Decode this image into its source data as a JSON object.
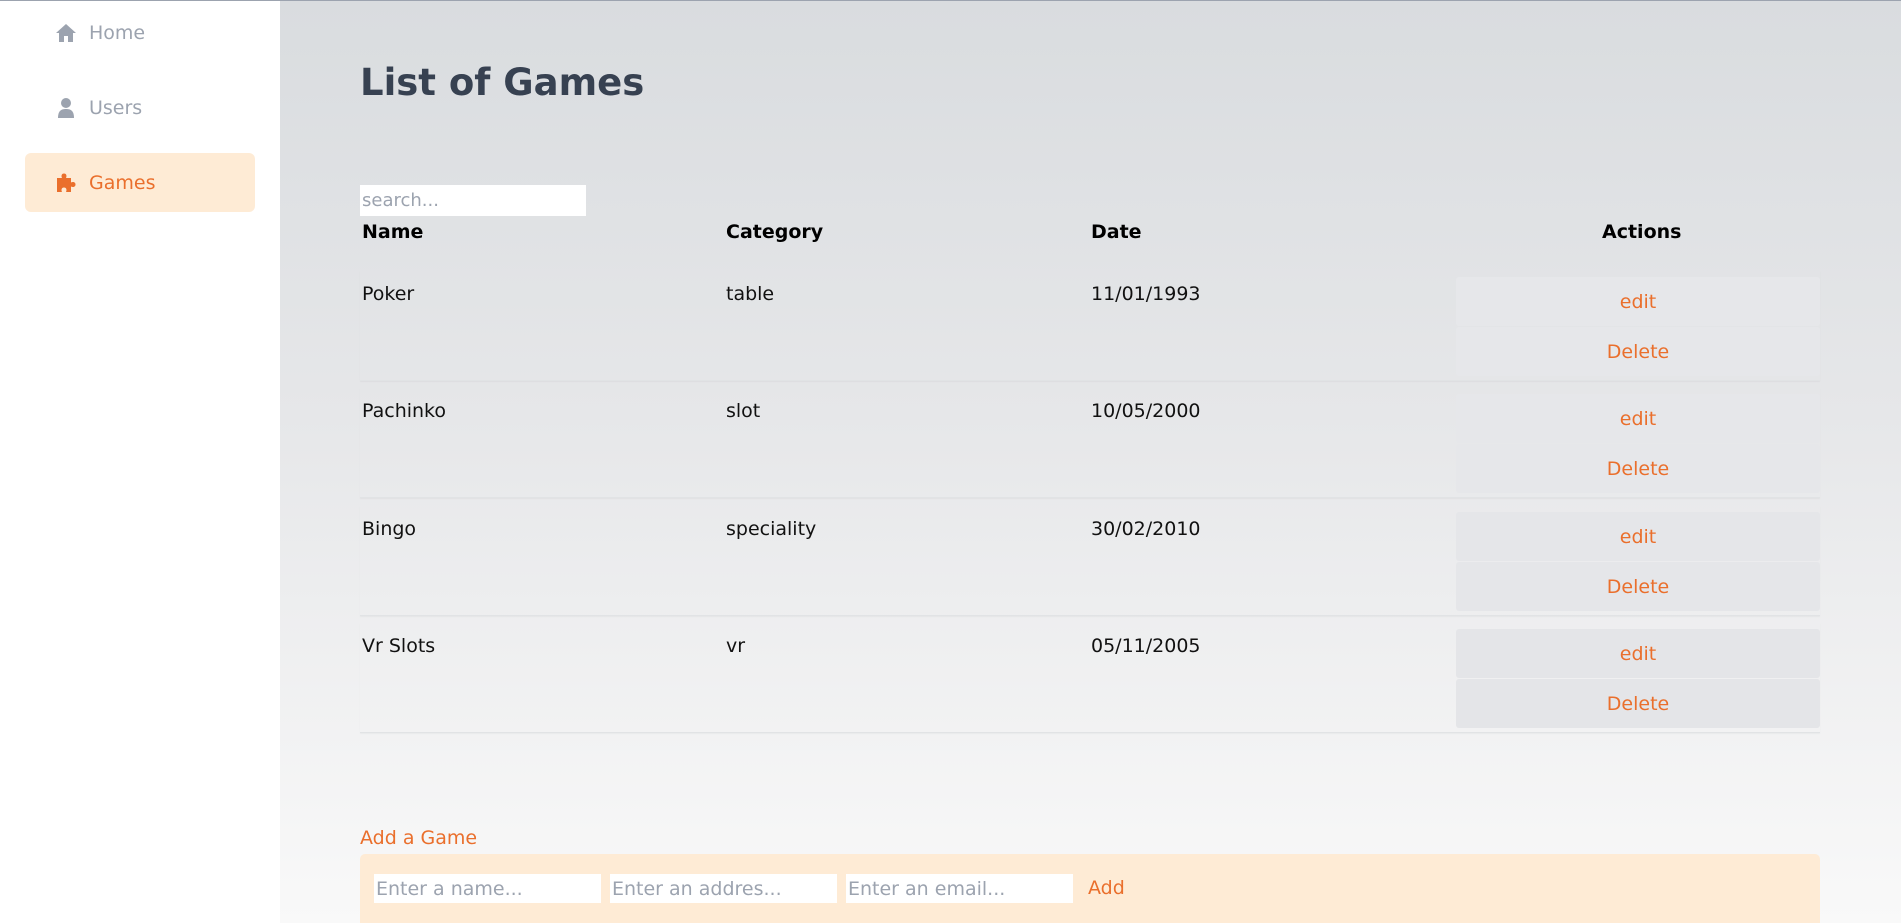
{
  "sidebar": {
    "items": [
      {
        "label": "Home",
        "icon": "home-icon"
      },
      {
        "label": "Users",
        "icon": "user-icon"
      },
      {
        "label": "Games",
        "icon": "puzzle-icon",
        "active": true
      }
    ]
  },
  "main": {
    "title": "List of Games",
    "search": {
      "placeholder": "search...",
      "value": ""
    },
    "table": {
      "headers": {
        "name": "Name",
        "category": "Category",
        "date": "Date",
        "actions": "Actions"
      },
      "rows": [
        {
          "name": "Poker",
          "category": "table",
          "date": "11/01/1993",
          "edit_label": "edit",
          "delete_label": "Delete"
        },
        {
          "name": "Pachinko",
          "category": "slot",
          "date": "10/05/2000",
          "edit_label": "edit",
          "delete_label": "Delete"
        },
        {
          "name": "Bingo",
          "category": "speciality",
          "date": "30/02/2010",
          "edit_label": "edit",
          "delete_label": "Delete"
        },
        {
          "name": "Vr Slots",
          "category": "vr",
          "date": "05/11/2005",
          "edit_label": "edit",
          "delete_label": "Delete"
        }
      ]
    },
    "add_form": {
      "title": "Add a Game",
      "name_placeholder": "Enter a name...",
      "address_placeholder": "Enter an addres...",
      "email_placeholder": "Enter an email...",
      "add_label": "Add"
    }
  },
  "colors": {
    "accent": "#ea6f2c",
    "accent_bg": "#feebd5",
    "muted_text": "#9ca3af",
    "title_text": "#374151",
    "button_bg": "#e5e7eb"
  }
}
